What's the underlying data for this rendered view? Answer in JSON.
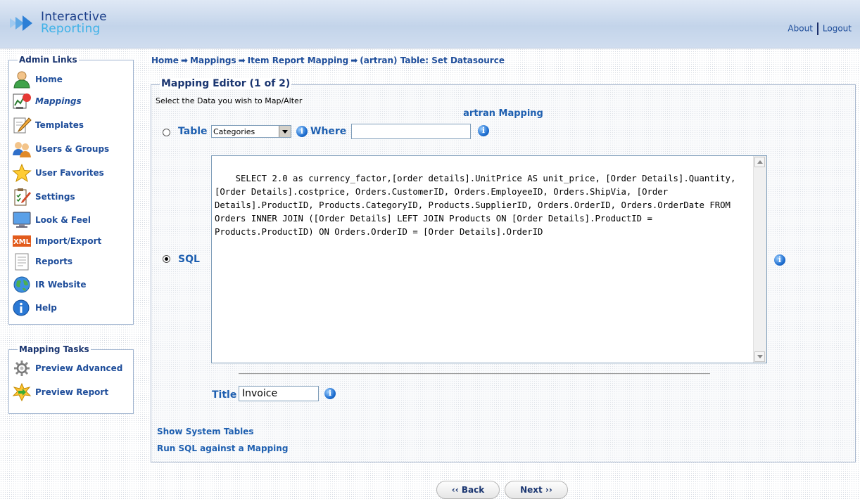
{
  "app": {
    "logo_line1": "Interactive",
    "logo_line2": "Reporting"
  },
  "header": {
    "about": "About",
    "logout": "Logout"
  },
  "admin_links": {
    "title": "Admin Links",
    "items": [
      {
        "label": "Home",
        "icon": "user-icon"
      },
      {
        "label": "Mappings",
        "icon": "mappings-chart-icon",
        "active": true
      },
      {
        "label": "Templates",
        "icon": "template-pencil-icon"
      },
      {
        "label": "Users & Groups",
        "icon": "users-groups-icon"
      },
      {
        "label": "User Favorites",
        "icon": "star-icon"
      },
      {
        "label": "Settings",
        "icon": "settings-clipboard-icon"
      },
      {
        "label": "Look & Feel",
        "icon": "monitor-icon"
      },
      {
        "label": "Import/Export",
        "icon": "xml-icon"
      },
      {
        "label": "Reports",
        "icon": "report-document-icon"
      },
      {
        "label": "IR Website",
        "icon": "globe-icon"
      },
      {
        "label": "Help",
        "icon": "help-info-icon"
      }
    ]
  },
  "mapping_tasks": {
    "title": "Mapping Tasks",
    "items": [
      {
        "label": "Preview Advanced",
        "icon": "gear-icon"
      },
      {
        "label": "Preview Report",
        "icon": "preview-star-arrow-icon"
      }
    ]
  },
  "breadcrumb": [
    "Home",
    "Mappings",
    "Item Report Mapping",
    "(artran) Table: Set Datasource"
  ],
  "breadcrumb_sep": "➡",
  "editor": {
    "title": "Mapping Editor (1 of 2)",
    "instruction": "Select the Data you wish to Map/Alter",
    "mapping_name": "artran Mapping",
    "table_label": "Table",
    "table_value": "Categories",
    "where_label": "Where",
    "where_value": "",
    "sql_label": "SQL",
    "sql_value": "SELECT 2.0 as currency_factor,[order details].UnitPrice AS unit_price, [Order Details].Quantity, [Order Details].costprice, Orders.CustomerID, Orders.EmployeeID, Orders.ShipVia, [Order Details].ProductID, Products.CategoryID, Products.SupplierID, Orders.OrderID, Orders.OrderDate FROM Orders INNER JOIN ([Order Details] LEFT JOIN Products ON [Order Details].ProductID = Products.ProductID) ON Orders.OrderID = [Order Details].OrderID",
    "title_label": "Title",
    "title_value": "Invoice",
    "show_system_tables": "Show System Tables",
    "run_sql": "Run SQL against a Mapping"
  },
  "buttons": {
    "back": "‹‹ Back",
    "next": "Next ››"
  }
}
